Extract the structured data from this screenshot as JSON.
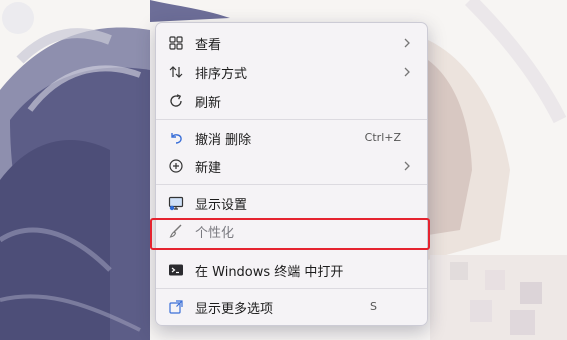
{
  "context_menu": {
    "items": [
      {
        "label": "查看",
        "icon": "grid-view-icon",
        "has_submenu": true
      },
      {
        "label": "排序方式",
        "icon": "sort-icon",
        "has_submenu": true
      },
      {
        "label": "刷新",
        "icon": "refresh-icon",
        "has_submenu": false
      },
      {
        "label": "撤消 删除",
        "icon": "undo-icon",
        "shortcut": "Ctrl+Z"
      },
      {
        "label": "新建",
        "icon": "new-plus-icon",
        "has_submenu": true
      },
      {
        "label": "显示设置",
        "icon": "display-settings-icon"
      },
      {
        "label": "个性化",
        "icon": "brush-icon",
        "highlighted": true
      },
      {
        "label": "在 Windows 终端 中打开",
        "icon": "terminal-icon"
      },
      {
        "label": "显示更多选项",
        "icon": "external-options-icon",
        "shortcut_partial": "S"
      }
    ]
  },
  "annotation": {
    "color": "#e5232f"
  }
}
